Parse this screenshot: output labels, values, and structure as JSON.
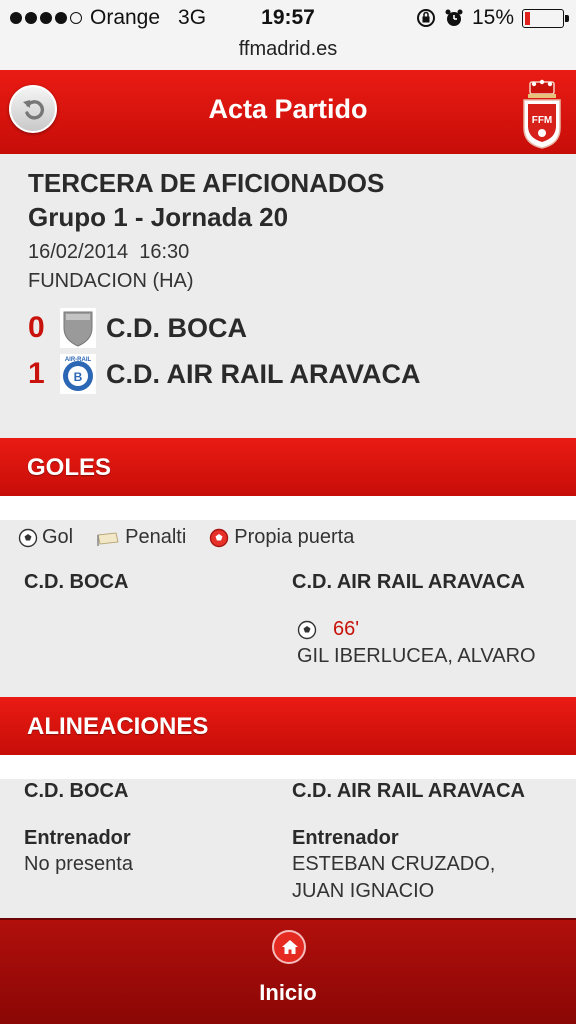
{
  "status": {
    "carrier": "Orange",
    "network": "3G",
    "time": "19:57",
    "battery_text": "15%",
    "battery_level": 0.15,
    "signal_bars_filled": 4,
    "signal_bars_total": 5
  },
  "url": "ffmadrid.es",
  "header": {
    "title": "Acta Partido",
    "back_icon": "back-arrow-icon",
    "crest_icon": "federation-crest-icon"
  },
  "match": {
    "competition": "TERCERA DE AFICIONADOS",
    "group": "Grupo 1 - Jornada 20",
    "datetime": "16/02/2014  16:30",
    "venue": "FUNDACION (HA)",
    "home": {
      "score": "0",
      "name": "C.D. BOCA"
    },
    "away": {
      "score": "1",
      "name": "C.D. AIR RAIL ARAVACA",
      "crest_text": "AIR-RAIL"
    }
  },
  "goals": {
    "section_title": "GOLES",
    "legend": {
      "goal": "Gol",
      "penalty": "Penalti",
      "own_goal": "Propia puerta"
    },
    "home_team": "C.D. BOCA",
    "away_team": "C.D. AIR RAIL ARAVACA",
    "away_goals": [
      {
        "minute": "66'",
        "player": "GIL IBERLUCEA, ALVARO"
      }
    ]
  },
  "lineups": {
    "section_title": "ALINEACIONES",
    "home_team": "C.D. BOCA",
    "away_team": "C.D. AIR RAIL ARAVACA",
    "coach_label": "Entrenador",
    "home_coach": "No presenta",
    "away_coach_line1": "ESTEBAN CRUZADO,",
    "away_coach_line2": "JUAN IGNACIO"
  },
  "footer": {
    "label": "Inicio",
    "icon": "home-icon"
  },
  "colors": {
    "primary_red": "#e0140e",
    "score_red": "#c8120b",
    "footer_red": "#a00b08"
  }
}
